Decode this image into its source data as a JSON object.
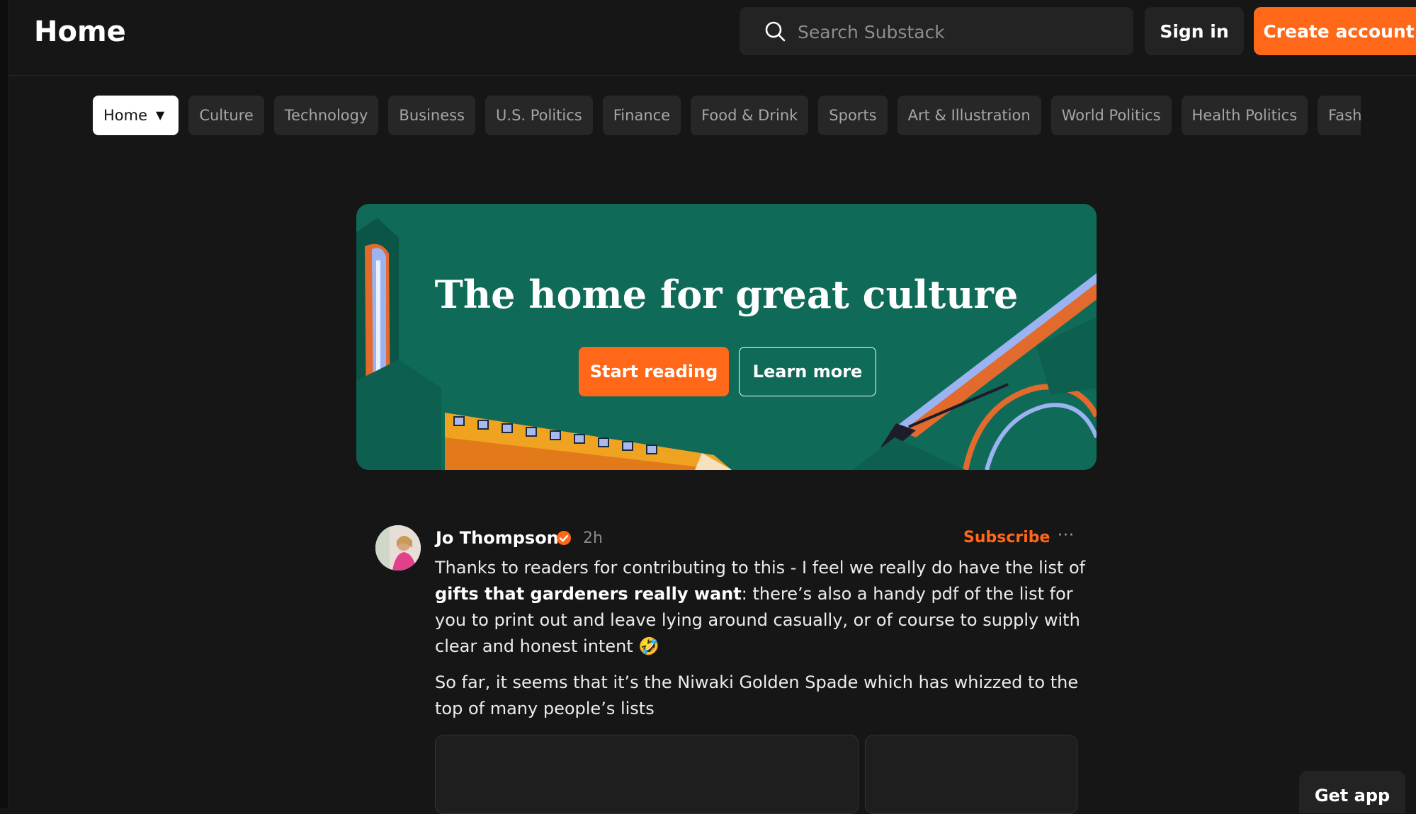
{
  "header": {
    "title": "Home",
    "search": {
      "placeholder": "Search Substack"
    },
    "sign_in_label": "Sign in",
    "create_account_label": "Create account"
  },
  "categories": [
    {
      "label": "Home",
      "active": true
    },
    {
      "label": "Culture"
    },
    {
      "label": "Technology"
    },
    {
      "label": "Business"
    },
    {
      "label": "U.S. Politics"
    },
    {
      "label": "Finance"
    },
    {
      "label": "Food & Drink"
    },
    {
      "label": "Sports"
    },
    {
      "label": "Art & Illustration"
    },
    {
      "label": "World Politics"
    },
    {
      "label": "Health Politics"
    },
    {
      "label": "Fashi"
    }
  ],
  "hero": {
    "title": "The home for great culture",
    "start_label": "Start reading",
    "learn_label": "Learn more"
  },
  "post": {
    "author": "Jo Thompson",
    "time": "2h",
    "subscribe_label": "Subscribe",
    "more_label": "···",
    "para1_before": "Thanks to readers for contributing to this - I feel we really do have the list of ",
    "para1_bold": "gifts that gardeners really want",
    "para1_after": ": there’s also a handy pdf of the list for you to print out and leave lying around casually, or of course to supply with clear and honest intent 🤣",
    "para2": "So far, it seems that it’s the Niwaki Golden Spade which has whizzed to the top of many people’s lists"
  },
  "get_app_label": "Get app",
  "colors": {
    "accent": "#ff6719",
    "background": "#161616",
    "hero_green": "#0f6b58",
    "surface": "#232323"
  },
  "icons": {
    "search": "search-icon",
    "verified": "verified-badge-icon",
    "caret": "caret-down-icon",
    "more": "more-options-icon"
  }
}
